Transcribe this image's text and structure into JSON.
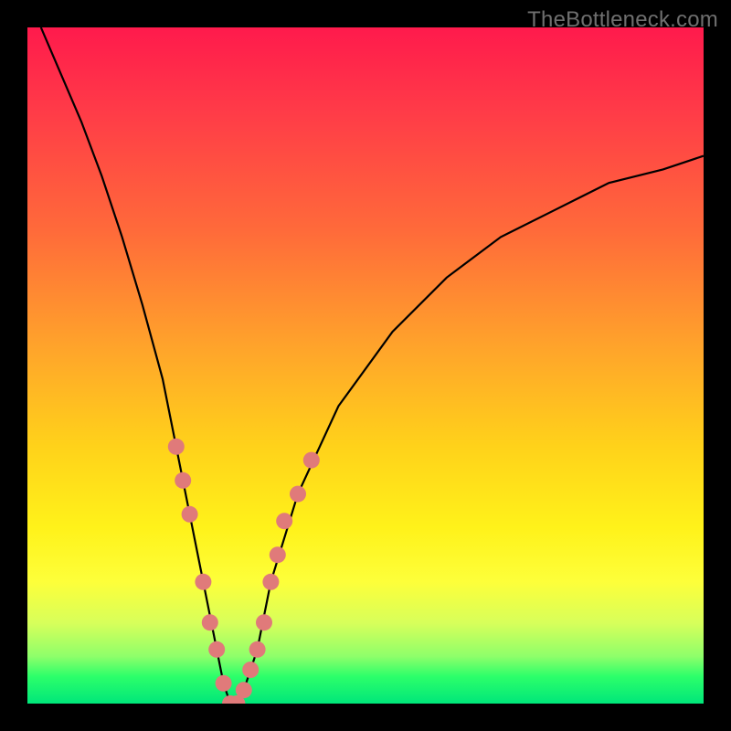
{
  "watermark": "TheBottleneck.com",
  "chart_data": {
    "type": "line",
    "title": "",
    "xlabel": "",
    "ylabel": "",
    "xlim": [
      0,
      100
    ],
    "ylim": [
      0,
      100
    ],
    "series": [
      {
        "name": "bottleneck-curve",
        "x": [
          2,
          5,
          8,
          11,
          14,
          17,
          20,
          22,
          24,
          26,
          28,
          29,
          30,
          31,
          32,
          34,
          36,
          40,
          46,
          54,
          62,
          70,
          78,
          86,
          94,
          100
        ],
        "values": [
          100,
          93,
          86,
          78,
          69,
          59,
          48,
          38,
          28,
          18,
          8,
          3,
          0,
          0,
          2,
          8,
          18,
          31,
          44,
          55,
          63,
          69,
          73,
          77,
          79,
          81
        ]
      }
    ],
    "markers": {
      "name": "highlighted-points",
      "x": [
        22,
        23,
        24,
        26,
        27,
        28,
        29,
        30,
        31,
        32,
        33,
        34,
        35,
        36,
        37,
        38,
        40,
        42
      ],
      "values": [
        38,
        33,
        28,
        18,
        12,
        8,
        3,
        0,
        0,
        2,
        5,
        8,
        12,
        18,
        22,
        27,
        31,
        36
      ]
    },
    "background_gradient": {
      "direction": "vertical",
      "stops": [
        {
          "pos": 0,
          "color": "#ff1a4c"
        },
        {
          "pos": 30,
          "color": "#ff6a3a"
        },
        {
          "pos": 62,
          "color": "#ffd21a"
        },
        {
          "pos": 82,
          "color": "#fdff3a"
        },
        {
          "pos": 96,
          "color": "#2cff6a"
        },
        {
          "pos": 100,
          "color": "#00e67a"
        }
      ]
    }
  }
}
